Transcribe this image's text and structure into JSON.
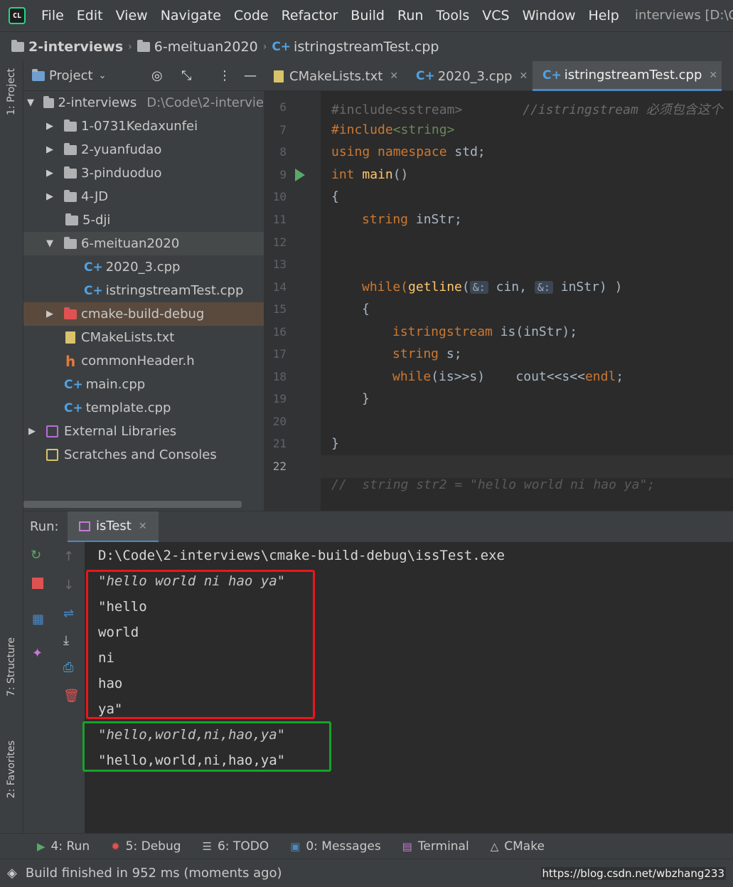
{
  "menu": {
    "logo": "CL",
    "items": [
      "File",
      "Edit",
      "View",
      "Navigate",
      "Code",
      "Refactor",
      "Build",
      "Run",
      "Tools",
      "VCS",
      "Window",
      "Help"
    ],
    "window_title": "interviews [D:\\C"
  },
  "breadcrumb": [
    "2-interviews",
    "6-meituan2020",
    "istringstreamTest.cpp"
  ],
  "left_strip": {
    "project_tab": "1: Project",
    "structure_tab": "7: Structure",
    "favorites_tab": "2: Favorites"
  },
  "project_panel": {
    "title": "Project",
    "tree": [
      {
        "label": "2-interviews",
        "path": "D:\\Code\\2-intervie"
      },
      {
        "label": "1-0731Kedaxunfei"
      },
      {
        "label": "2-yuanfudao"
      },
      {
        "label": "3-pinduoduo"
      },
      {
        "label": "4-JD"
      },
      {
        "label": "5-dji"
      },
      {
        "label": "6-meituan2020"
      },
      {
        "label": "2020_3.cpp"
      },
      {
        "label": "istringstreamTest.cpp"
      },
      {
        "label": "cmake-build-debug"
      },
      {
        "label": "CMakeLists.txt"
      },
      {
        "label": "commonHeader.h"
      },
      {
        "label": "main.cpp"
      },
      {
        "label": "template.cpp"
      },
      {
        "label": "External Libraries"
      },
      {
        "label": "Scratches and Consoles"
      }
    ]
  },
  "editor_tabs": [
    "CMakeLists.txt",
    "2020_3.cpp",
    "istringstreamTest.cpp"
  ],
  "editor": {
    "line_numbers": [
      "6",
      "7",
      "8",
      "9",
      "10",
      "11",
      "12",
      "13",
      "14",
      "15",
      "16",
      "17",
      "18",
      "19",
      "20",
      "21",
      "22"
    ],
    "l6_include": "#include<sstream>",
    "l6_comment": "//istringstream 必须包含这个",
    "l7_include": "#include",
    "l7_header": "<string>",
    "l8_using": "using namespace",
    "l8_std": " std;",
    "l9_int": "int ",
    "l9_main": "main",
    "l9_rest": "()",
    "l10": "{",
    "l11_type": "string ",
    "l11_rest": "inStr;",
    "l14_while": "while(",
    "l14_getline": "getline",
    "l14_paren": "(",
    "l14_hint": "&:",
    "l14_cin": " cin, ",
    "l14_instr": " inStr) )",
    "l15": "{",
    "l16_type": "istringstream ",
    "l16_rest": "is(inStr);",
    "l17_type": "string ",
    "l17_rest": "s;",
    "l18_while": "while",
    "l18_rest": "(is>>s)    cout<<s<<",
    "l18_endl": "endl",
    "l18_semi": ";",
    "l19": "}",
    "l21": "}",
    "l23_partial": "//  string str2 = \"hello world ni hao ya\";"
  },
  "run": {
    "label": "Run:",
    "tab": "isTest",
    "console": [
      "D:\\Code\\2-interviews\\cmake-build-debug\\issTest.exe",
      "\"hello world ni hao ya\"",
      "\"hello",
      "world",
      "ni",
      "hao",
      "ya\"",
      "\"hello,world,ni,hao,ya\"",
      "\"hello,world,ni,hao,ya\""
    ],
    "highlight_colors": {
      "red_box": "#e8171b",
      "green_box": "#15a329"
    }
  },
  "bottom_tools": [
    "4: Run",
    "5: Debug",
    "6: TODO",
    "0: Messages",
    "Terminal",
    "CMake"
  ],
  "status": {
    "text": "Build finished in 952 ms (moments ago)"
  },
  "watermark": "https://blog.csdn.net/wbzhang233"
}
